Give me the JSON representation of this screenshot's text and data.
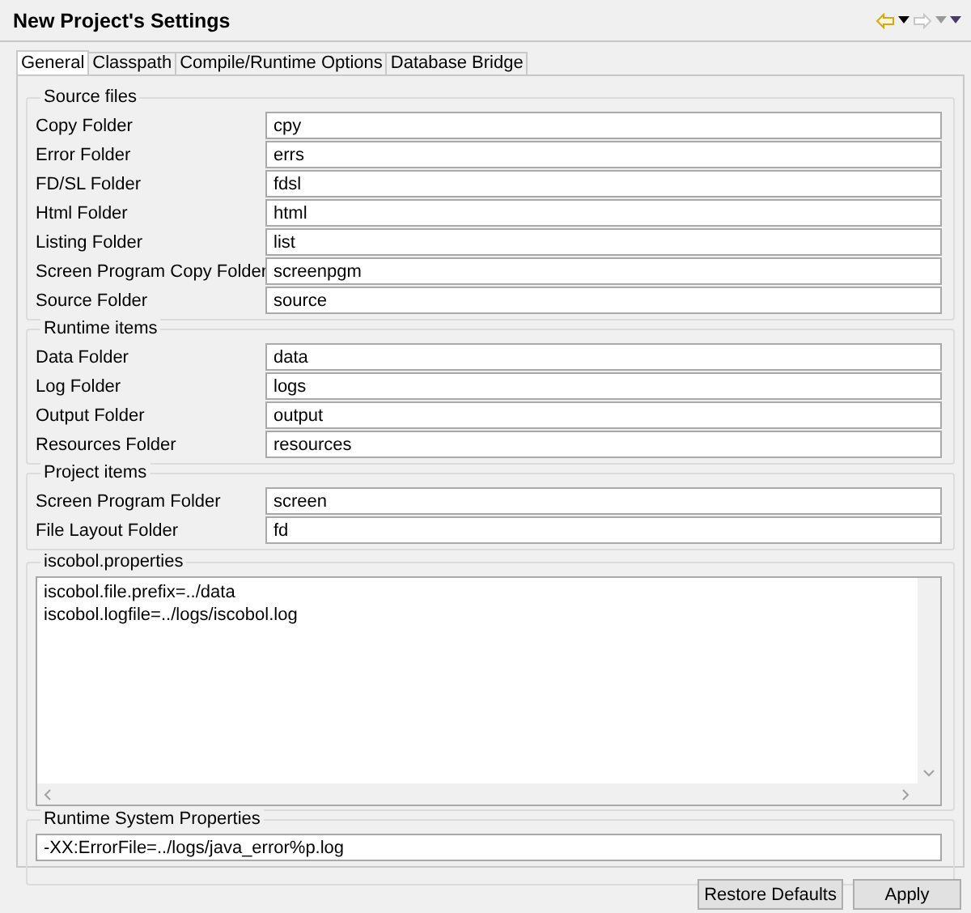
{
  "window": {
    "title": "New Project's Settings"
  },
  "nav": {
    "back_disabled": false,
    "forward_disabled": true
  },
  "tabs": [
    {
      "label": "General",
      "selected": true
    },
    {
      "label": "Classpath",
      "selected": false
    },
    {
      "label": "Compile/Runtime Options",
      "selected": false
    },
    {
      "label": "Database Bridge",
      "selected": false
    }
  ],
  "groups": [
    {
      "title": "Source files",
      "fields": [
        {
          "label": "Copy Folder",
          "value": "cpy"
        },
        {
          "label": "Error Folder",
          "value": "errs"
        },
        {
          "label": "FD/SL Folder",
          "value": "fdsl"
        },
        {
          "label": "Html Folder",
          "value": "html"
        },
        {
          "label": "Listing Folder",
          "value": "list"
        },
        {
          "label": "Screen Program Copy Folder",
          "value": "screenpgm"
        },
        {
          "label": "Source Folder",
          "value": "source"
        }
      ]
    },
    {
      "title": "Runtime items",
      "fields": [
        {
          "label": "Data Folder",
          "value": "data"
        },
        {
          "label": "Log Folder",
          "value": "logs"
        },
        {
          "label": "Output Folder",
          "value": "output"
        },
        {
          "label": "Resources Folder",
          "value": "resources"
        }
      ]
    },
    {
      "title": "Project items",
      "fields": [
        {
          "label": "Screen Program Folder",
          "value": "screen"
        },
        {
          "label": "File Layout Folder",
          "value": "fd"
        }
      ]
    }
  ],
  "properties": {
    "title": "iscobol.properties",
    "lines": [
      "iscobol.file.prefix=../data",
      "iscobol.logfile=../logs/iscobol.log"
    ]
  },
  "runtime_system_properties": {
    "title": "Runtime System Properties",
    "value": "-XX:ErrorFile=../logs/java_error%p.log"
  },
  "buttons": [
    "Restore Defaults",
    "Apply"
  ]
}
